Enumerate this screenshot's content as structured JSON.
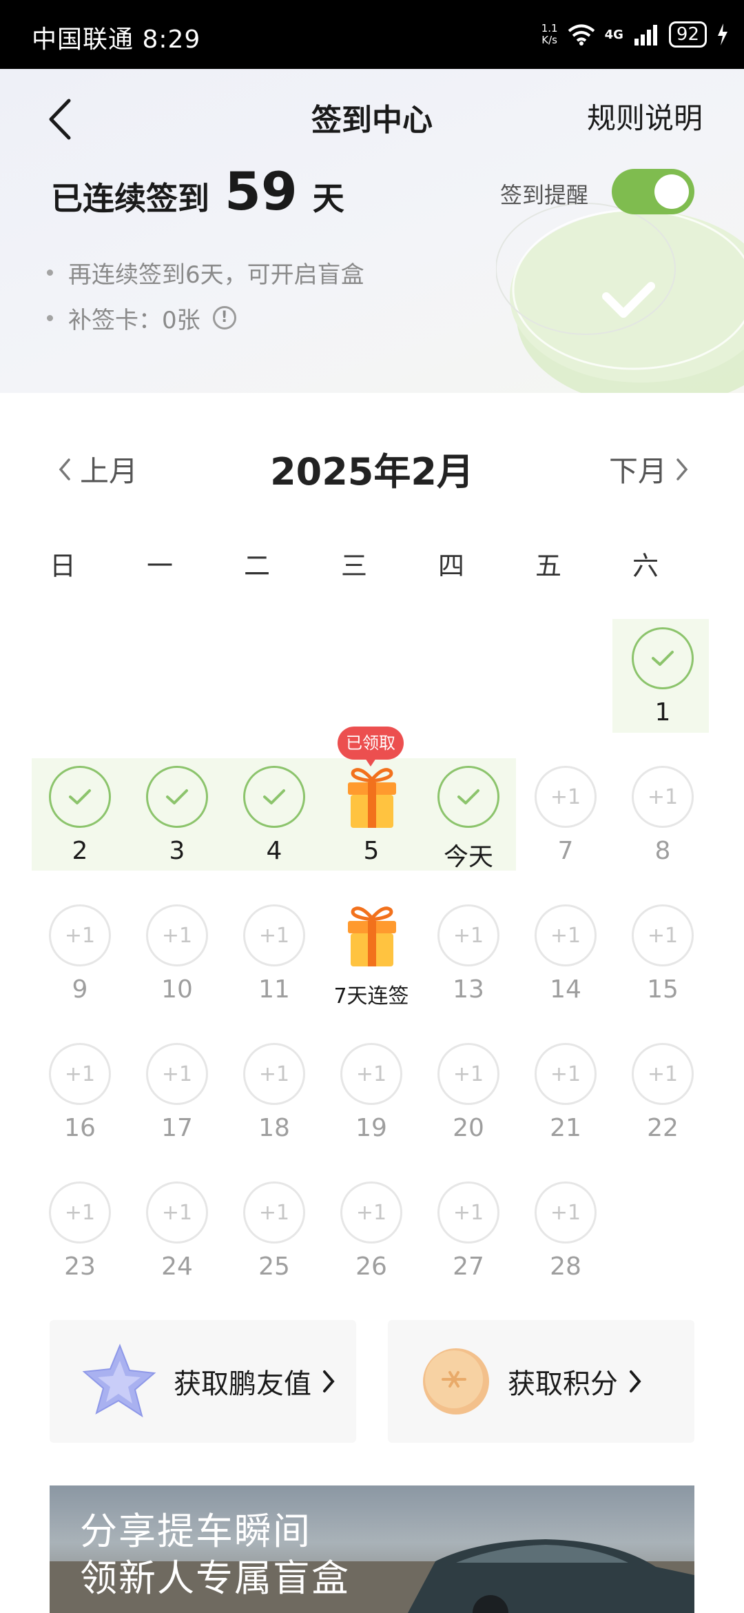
{
  "status_bar": {
    "carrier_time": "中国联通 8:29",
    "speed_top": "1.1",
    "speed_bottom": "K/s",
    "network": "4G",
    "battery": "92"
  },
  "header": {
    "title": "签到中心",
    "rules_link": "规则说明",
    "streak_prefix": "已连续签到",
    "streak_days": "59",
    "streak_suffix": "天",
    "reminder_label": "签到提醒",
    "reminder_on": true,
    "bullets": [
      "再连续签到6天，可开启盲盒",
      "补签卡：0张"
    ],
    "info_glyph": "!"
  },
  "calendar": {
    "prev_label": "上月",
    "month_title": "2025年2月",
    "next_label": "下月",
    "weekdays": [
      "日",
      "一",
      "二",
      "三",
      "四",
      "五",
      "六"
    ],
    "plus_label": "+1",
    "claimed_badge": "已领取",
    "days": [
      {
        "label": "1",
        "col": 6,
        "row": 0,
        "state": "checked"
      },
      {
        "label": "2",
        "col": 0,
        "row": 1,
        "state": "checked"
      },
      {
        "label": "3",
        "col": 1,
        "row": 1,
        "state": "checked"
      },
      {
        "label": "4",
        "col": 2,
        "row": 1,
        "state": "checked"
      },
      {
        "label": "5",
        "col": 3,
        "row": 1,
        "state": "gift_claimed"
      },
      {
        "label": "今天",
        "col": 4,
        "row": 1,
        "state": "checked"
      },
      {
        "label": "7",
        "col": 5,
        "row": 1,
        "state": "plus"
      },
      {
        "label": "8",
        "col": 6,
        "row": 1,
        "state": "plus"
      },
      {
        "label": "9",
        "col": 0,
        "row": 2,
        "state": "plus"
      },
      {
        "label": "10",
        "col": 1,
        "row": 2,
        "state": "plus"
      },
      {
        "label": "11",
        "col": 2,
        "row": 2,
        "state": "plus"
      },
      {
        "label": "7天连签",
        "col": 3,
        "row": 2,
        "state": "gift"
      },
      {
        "label": "13",
        "col": 4,
        "row": 2,
        "state": "plus"
      },
      {
        "label": "14",
        "col": 5,
        "row": 2,
        "state": "plus"
      },
      {
        "label": "15",
        "col": 6,
        "row": 2,
        "state": "plus"
      },
      {
        "label": "16",
        "col": 0,
        "row": 3,
        "state": "plus"
      },
      {
        "label": "17",
        "col": 1,
        "row": 3,
        "state": "plus"
      },
      {
        "label": "18",
        "col": 2,
        "row": 3,
        "state": "plus"
      },
      {
        "label": "19",
        "col": 3,
        "row": 3,
        "state": "plus"
      },
      {
        "label": "20",
        "col": 4,
        "row": 3,
        "state": "plus"
      },
      {
        "label": "21",
        "col": 5,
        "row": 3,
        "state": "plus"
      },
      {
        "label": "22",
        "col": 6,
        "row": 3,
        "state": "plus"
      },
      {
        "label": "23",
        "col": 0,
        "row": 4,
        "state": "plus"
      },
      {
        "label": "24",
        "col": 1,
        "row": 4,
        "state": "plus"
      },
      {
        "label": "25",
        "col": 2,
        "row": 4,
        "state": "plus"
      },
      {
        "label": "26",
        "col": 3,
        "row": 4,
        "state": "plus"
      },
      {
        "label": "27",
        "col": 4,
        "row": 4,
        "state": "plus"
      },
      {
        "label": "28",
        "col": 5,
        "row": 4,
        "state": "plus"
      }
    ]
  },
  "cards": [
    {
      "label": "获取鹏友值",
      "icon": "star-icon"
    },
    {
      "label": "获取积分",
      "icon": "coin-icon"
    }
  ],
  "banner": {
    "line1": "分享提车瞬间",
    "line2": "领新人专属盲盒"
  },
  "colors": {
    "accent_green": "#7fbc4f",
    "checked_bg": "#f3f9ec",
    "badge_red": "#ec4f4f"
  }
}
